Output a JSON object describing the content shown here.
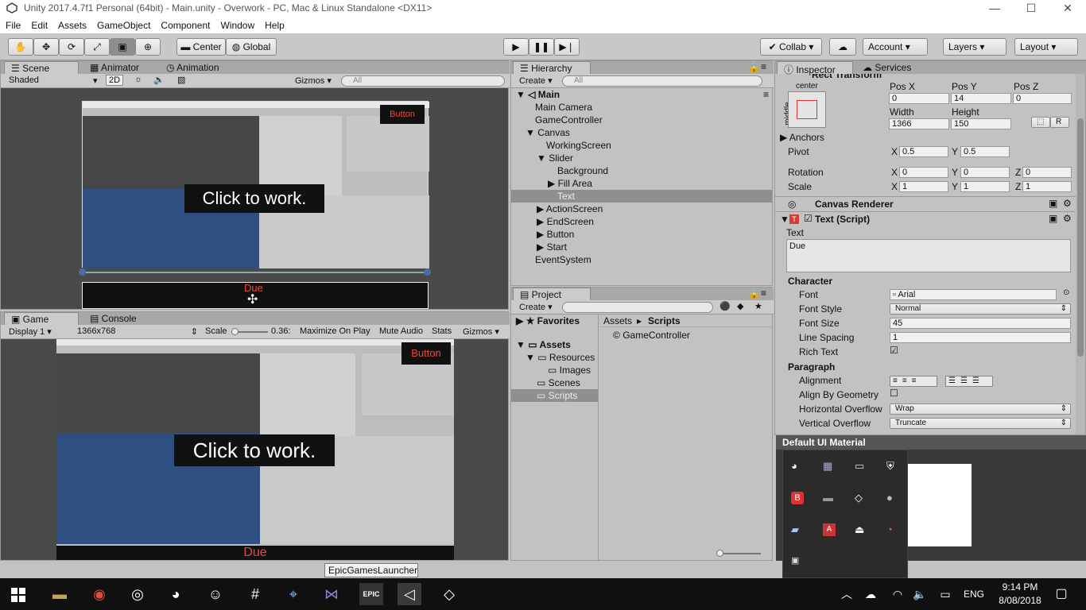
{
  "window": {
    "title": "Unity 2017.4.7f1 Personal (64bit) - Main.unity - Overwork - PC, Mac & Linux Standalone <DX11>",
    "controls": [
      "—",
      "☐",
      "✕"
    ]
  },
  "menu": [
    "File",
    "Edit",
    "Assets",
    "GameObject",
    "Component",
    "Window",
    "Help"
  ],
  "toolbar": {
    "pivot": "Center",
    "space": "Global",
    "collab": "Collab",
    "account": "Account",
    "layers": "Layers",
    "layout": "Layout"
  },
  "scene": {
    "tabs": [
      "Scene",
      "Animator",
      "Animation"
    ],
    "shading": "Shaded",
    "mode2d": "2D",
    "gizmos": "Gizmos",
    "search": "All",
    "button_label": "Button",
    "click_text": "Click to work.",
    "due_text": "Due"
  },
  "game": {
    "tabs": [
      "Game",
      "Console"
    ],
    "display": "Display 1",
    "resolution": "1366x768",
    "scale_label": "Scale",
    "scale_value": "0.36:",
    "maximize": "Maximize On Play",
    "mute": "Mute Audio",
    "stats": "Stats",
    "gizmos": "Gizmos",
    "button_label": "Button",
    "click_text": "Click to work.",
    "due_text": "Due"
  },
  "hierarchy": {
    "tab": "Hierarchy",
    "create": "Create",
    "search": "All",
    "scene": "Main",
    "items": [
      "Main Camera",
      "GameController",
      "Canvas",
      "WorkingScreen",
      "Slider",
      "Background",
      "Fill Area",
      "Text",
      "ActionScreen",
      "EndScreen",
      "Button",
      "Start",
      "EventSystem"
    ]
  },
  "project": {
    "tab": "Project",
    "create": "Create",
    "favorites": "Favorites",
    "assets": "Assets",
    "folders": [
      "Resources",
      "Images",
      "Scenes",
      "Scripts"
    ],
    "breadcrumb": [
      "Assets",
      "Scripts"
    ],
    "files": [
      "GameController"
    ]
  },
  "inspector": {
    "tabs": [
      "Inspector",
      "Services"
    ],
    "rect_title": "Rect Transform",
    "anchor_h": "center",
    "anchor_v": "middle",
    "pos_labels": [
      "Pos X",
      "Pos Y",
      "Pos Z"
    ],
    "pos_values": [
      "0",
      "14",
      "0"
    ],
    "size_labels": [
      "Width",
      "Height"
    ],
    "size_values": [
      "1366",
      "150"
    ],
    "anchors": "Anchors",
    "pivot": "Pivot",
    "pivot_x": "0.5",
    "pivot_y": "0.5",
    "rotation": "Rotation",
    "rot_values": [
      "0",
      "0",
      "0"
    ],
    "scale": "Scale",
    "scale_values": [
      "1",
      "1",
      "1"
    ],
    "axis_x": "X",
    "axis_y": "Y",
    "axis_z": "Z",
    "r_btn": "R",
    "canvas_renderer": "Canvas Renderer",
    "text_script": "Text (Script)",
    "text_label": "Text",
    "text_value": "Due",
    "character": "Character",
    "font_label": "Font",
    "font_value": "Arial",
    "font_style_label": "Font Style",
    "font_style_value": "Normal",
    "font_size_label": "Font Size",
    "font_size_value": "45",
    "line_spacing_label": "Line Spacing",
    "line_spacing_value": "1",
    "rich_text_label": "Rich Text",
    "paragraph": "Paragraph",
    "alignment_label": "Alignment",
    "align_geom_label": "Align By Geometry",
    "h_overflow_label": "Horizontal Overflow",
    "h_overflow_value": "Wrap",
    "v_overflow_label": "Vertical Overflow",
    "v_overflow_value": "Truncate",
    "material": "Default UI Material"
  },
  "tooltip": "EpicGamesLauncher",
  "taskbar": {
    "lang": "ENG",
    "time": "9:14 PM",
    "date": "8/08/2018"
  }
}
